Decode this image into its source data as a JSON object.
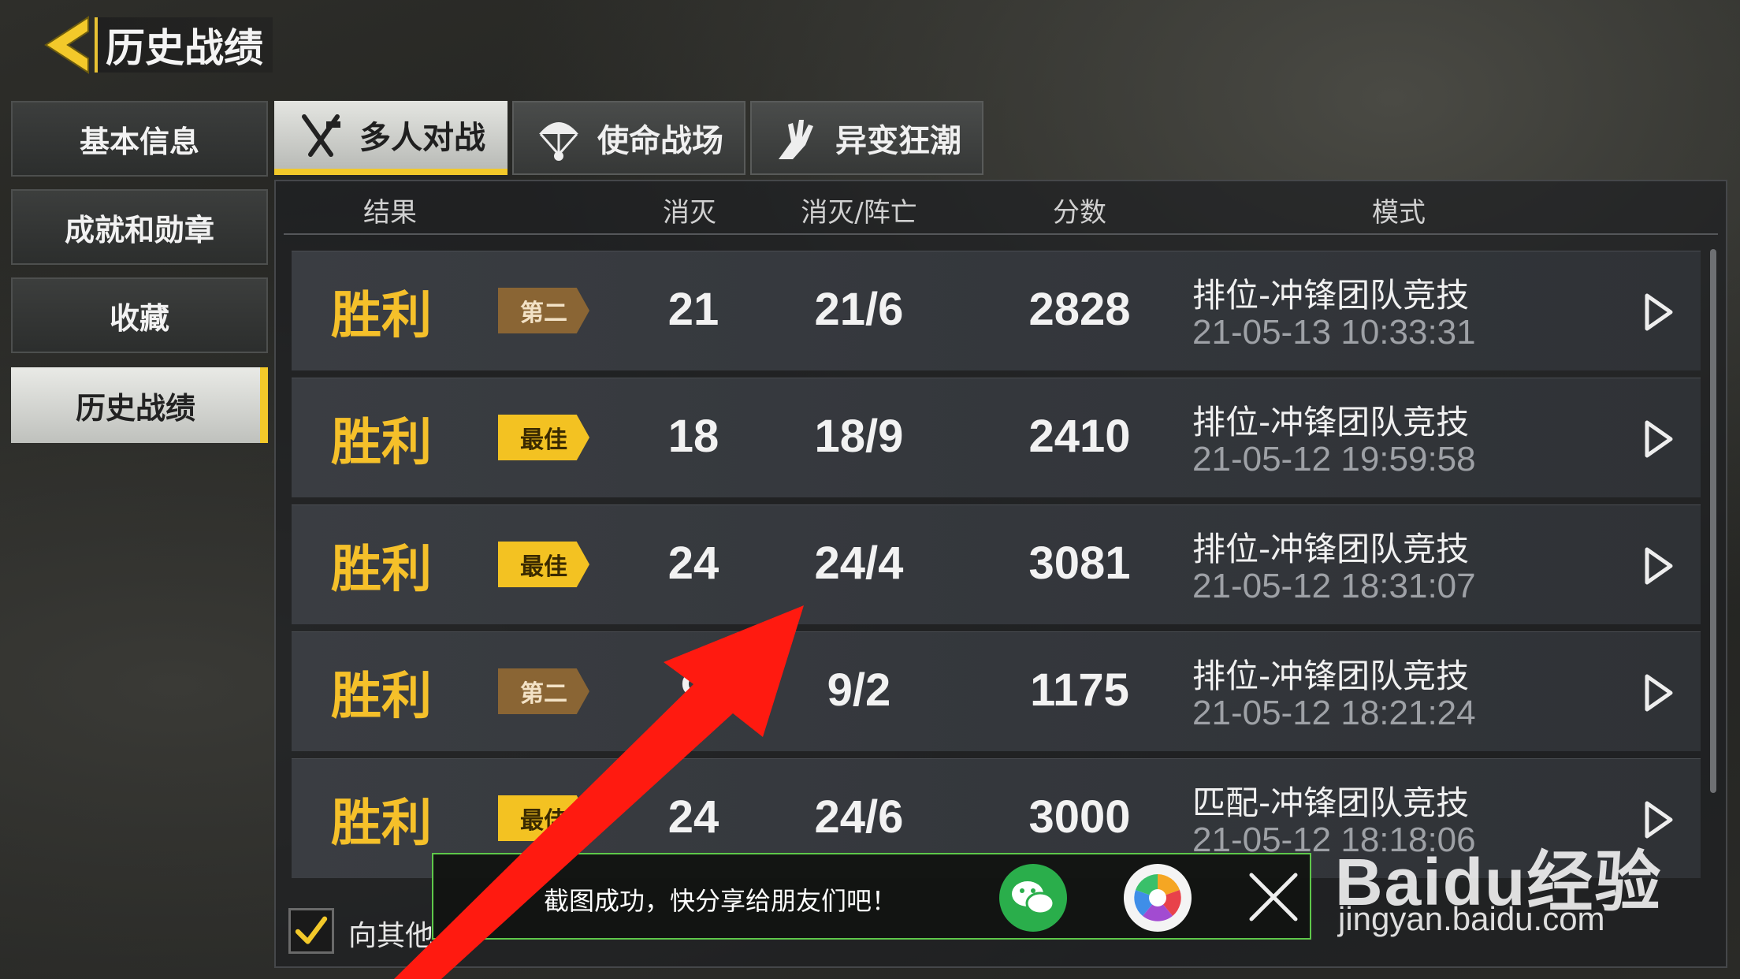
{
  "header": {
    "title": "历史战绩"
  },
  "sidebar": {
    "items": [
      {
        "label": "基本信息"
      },
      {
        "label": "成就和勋章"
      },
      {
        "label": "收藏"
      },
      {
        "label": "历史战绩"
      }
    ],
    "active_index": 3
  },
  "tabs": [
    {
      "label": "多人对战",
      "icon": "crossed-guns-icon"
    },
    {
      "label": "使命战场",
      "icon": "parachute-icon"
    },
    {
      "label": "异变狂潮",
      "icon": "zombie-hand-icon"
    }
  ],
  "table": {
    "headers": {
      "result": "结果",
      "kills": "消灭",
      "kd": "消灭/阵亡",
      "score": "分数",
      "mode": "模式"
    },
    "rows": [
      {
        "result": "胜利",
        "rank": "第二",
        "rank_type": "second",
        "kills": "21",
        "kd": "21/6",
        "score": "2828",
        "mode": "排位-冲锋团队竞技",
        "time": "21-05-13 10:33:31"
      },
      {
        "result": "胜利",
        "rank": "最佳",
        "rank_type": "best",
        "kills": "18",
        "kd": "18/9",
        "score": "2410",
        "mode": "排位-冲锋团队竞技",
        "time": "21-05-12 19:59:58"
      },
      {
        "result": "胜利",
        "rank": "最佳",
        "rank_type": "best",
        "kills": "24",
        "kd": "24/4",
        "score": "3081",
        "mode": "排位-冲锋团队竞技",
        "time": "21-05-12 18:31:07"
      },
      {
        "result": "胜利",
        "rank": "第二",
        "rank_type": "second",
        "kills": "9",
        "kd": "9/2",
        "score": "1175",
        "mode": "排位-冲锋团队竞技",
        "time": "21-05-12 18:21:24"
      },
      {
        "result": "胜利",
        "rank": "最佳",
        "rank_type": "best",
        "kills": "24",
        "kd": "24/6",
        "score": "3000",
        "mode": "匹配-冲锋团队竞技",
        "time": "21-05-12 18:18:06"
      }
    ]
  },
  "footer": {
    "share_label": "向其他"
  },
  "toast": {
    "message": "截图成功，快分享给朋友们吧！"
  },
  "watermark": {
    "main": "Baidu经验",
    "sub": "jingyan.baidu.com"
  },
  "colors": {
    "accent": "#f3c92a",
    "result": "#f5c02a",
    "best_badge": "#f3c222",
    "second_badge": "#8a6534",
    "annotation_arrow": "#ff1a10"
  }
}
